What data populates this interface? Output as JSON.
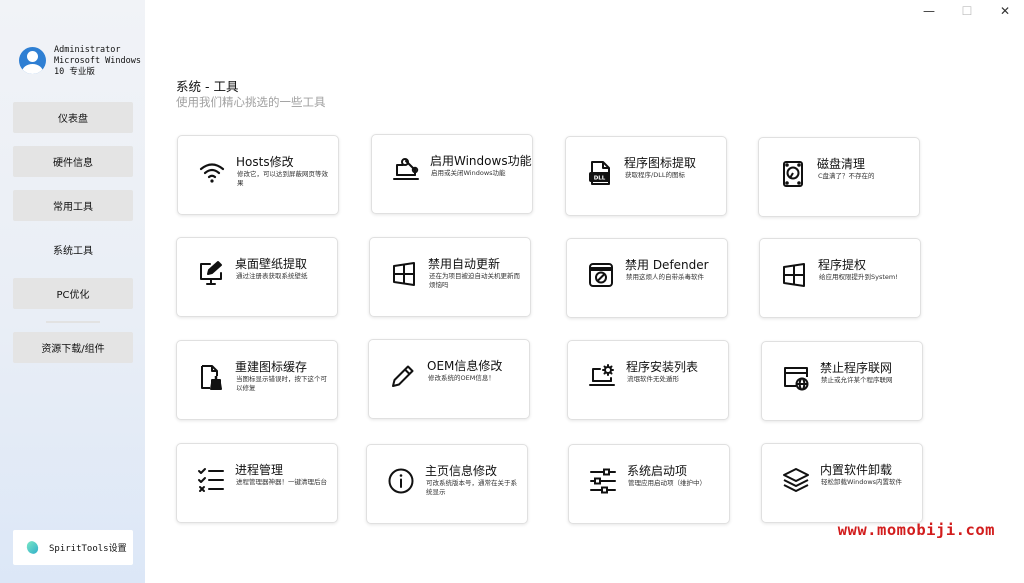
{
  "window": {
    "minimize": "—",
    "maximize": "☐",
    "close": "✕"
  },
  "user": {
    "name": "Administrator",
    "os_line1": "Microsoft Windows",
    "os_line2": "10 专业版"
  },
  "nav": [
    "仪表盘",
    "硬件信息",
    "常用工具",
    "系统工具",
    "PC优化",
    "资源下载/组件"
  ],
  "settings_label": "SpiritTools设置",
  "page": {
    "title": "系统 - 工具",
    "subtitle": "使用我们精心挑选的一些工具"
  },
  "cards": [
    {
      "title": "Hosts修改",
      "desc": "修改它，可以达到屏蔽网页等效果",
      "icon": "wifi-icon"
    },
    {
      "title": "启用Windows功能",
      "desc": "启用或关闭Windows功能",
      "icon": "laptop-wrench-icon"
    },
    {
      "title": "程序图标提取",
      "desc": "获取程序/DLL的图标",
      "icon": "dll-file-icon"
    },
    {
      "title": "磁盘清理",
      "desc": "C盘满了？不存在的",
      "icon": "disk-icon"
    },
    {
      "title": "桌面壁纸提取",
      "desc": "通过注册表获取系统壁纸",
      "icon": "monitor-edit-icon"
    },
    {
      "title": "禁用自动更新",
      "desc": "还在为项目被迫自动关机更新而烦恼吗",
      "icon": "windows-logo-icon"
    },
    {
      "title": "禁用 Defender",
      "desc": "禁用这烦人的自带杀毒软件",
      "icon": "blocked-window-icon"
    },
    {
      "title": "程序提权",
      "desc": "给应用权限提升到System!",
      "icon": "windows-logo-icon"
    },
    {
      "title": "重建图标缓存",
      "desc": "当图标显示错误时，按下这个可以修复",
      "icon": "file-brush-icon"
    },
    {
      "title": "OEM信息修改",
      "desc": "修改系统的OEM信息！",
      "icon": "pencil-icon"
    },
    {
      "title": "程序安装列表",
      "desc": "流氓软件无处遁形",
      "icon": "laptop-gear-icon"
    },
    {
      "title": "禁止程序联网",
      "desc": "禁止或允许某个程序联网",
      "icon": "globe-window-icon"
    },
    {
      "title": "进程管理",
      "desc": "进程管理器神器！一键清理后台",
      "icon": "checklist-icon"
    },
    {
      "title": "主页信息修改",
      "desc": "可改系统版本号，通常在关于系统显示",
      "icon": "info-icon"
    },
    {
      "title": "系统启动项",
      "desc": "管理应用启动项（维护中）",
      "icon": "sliders-icon"
    },
    {
      "title": "内置软件卸载",
      "desc": "轻松卸载Windows内置软件",
      "icon": "layers-icon"
    }
  ],
  "watermark": "www.momobiji.com"
}
